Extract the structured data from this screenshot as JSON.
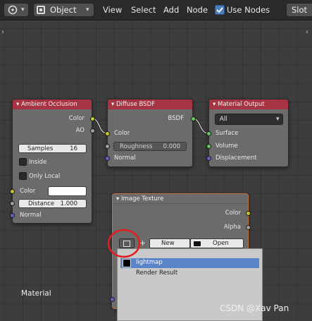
{
  "header": {
    "mode_icon": "view-rotate-icon",
    "mode": "Object",
    "menus": [
      "View",
      "Select",
      "Add",
      "Node"
    ],
    "use_nodes_label": "Use Nodes",
    "use_nodes_checked": true,
    "slot_label": "Slot"
  },
  "nodes": {
    "ambient_occlusion": {
      "title": "Ambient Occlusion",
      "outputs": [
        "Color",
        "AO"
      ],
      "samples_label": "Samples",
      "samples_value": "16",
      "inside_label": "Inside",
      "only_local_label": "Only Local",
      "color_label": "Color",
      "color_swatch": "#ffffff",
      "distance_label": "Distance",
      "distance_value": "1.000",
      "normal_label": "Normal"
    },
    "diffuse_bsdf": {
      "title": "Diffuse BSDF",
      "output": "BSDF",
      "color_label": "Color",
      "roughness_label": "Roughness",
      "roughness_value": "0.000",
      "normal_label": "Normal"
    },
    "material_output": {
      "title": "Material Output",
      "target": "All",
      "inputs": [
        "Surface",
        "Volume",
        "Displacement"
      ]
    },
    "image_texture": {
      "title": "Image Texture",
      "outputs": [
        "Color",
        "Alpha"
      ],
      "new_label": "New",
      "open_label": "Open"
    }
  },
  "image_popup": {
    "items": [
      "lightmap",
      "Render Result"
    ],
    "selected_index": 0
  },
  "footer": {
    "material_label": "Material"
  },
  "watermark": "CSDN @Xav Pan",
  "colors": {
    "node_header_red": "#a73442",
    "node_header_orange": "#c6703f",
    "socket_yellow": "#c7c729",
    "socket_green": "#63c763",
    "socket_gray": "#a1a1a1",
    "socket_blue": "#6363c7",
    "popup_highlight": "#5a84c7",
    "annotation_circle": "#e21d1d"
  }
}
